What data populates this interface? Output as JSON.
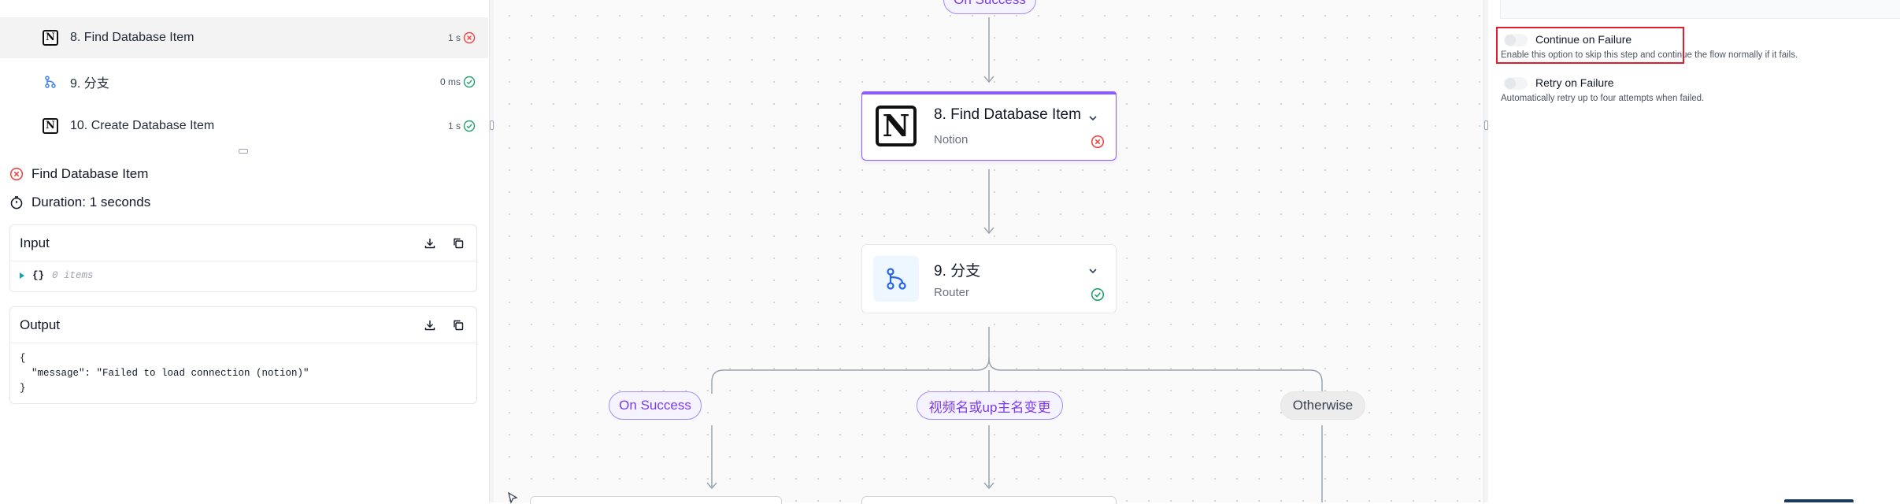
{
  "run_steps": [
    {
      "label": "8. Find Database Item",
      "duration": "1 s",
      "status": "failed",
      "icon": "notion-icon",
      "active": true
    },
    {
      "label": "9. 分支",
      "duration": "0 ms",
      "status": "success",
      "icon": "router-icon",
      "active": false
    },
    {
      "label": "10. Create Database Item",
      "duration": "1 s",
      "status": "success",
      "icon": "notion-icon",
      "active": false
    }
  ],
  "detail": {
    "step_name": "Find Database Item",
    "duration": "Duration: 1 seconds",
    "input": {
      "title": "Input",
      "brace": "{}",
      "count": "0 items"
    },
    "output": {
      "title": "Output",
      "json": "{\n  \"message\": \"Failed to load connection (notion)\"\n}"
    }
  },
  "canvas": {
    "top_branch_label": "On Success",
    "nodes": [
      {
        "title": "8. Find Database Item",
        "subtitle": "Notion",
        "status": "failed",
        "logo": "N"
      },
      {
        "title": "9. 分支",
        "subtitle": "Router",
        "status": "success"
      }
    ],
    "branches": [
      "On Success",
      "视频名或up主名变更",
      "Otherwise"
    ]
  },
  "settings": {
    "continue_on_failure": {
      "label": "Continue on Failure",
      "description": "Enable this option to skip this step and continue the flow normally if it fails.",
      "enabled": false
    },
    "retry_on_failure": {
      "label": "Retry on Failure",
      "description": "Automatically retry up to four attempts when failed.",
      "enabled": false
    }
  },
  "colors": {
    "accent": "#8b5cf6",
    "error": "#ef4444",
    "success": "#22a06b",
    "highlight": "#e11d2e"
  }
}
